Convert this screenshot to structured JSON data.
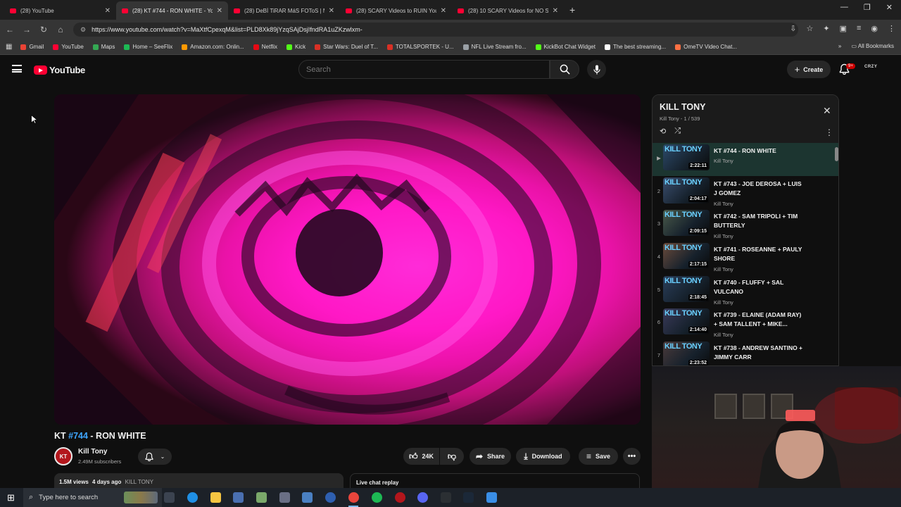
{
  "browser": {
    "tabs": [
      {
        "title": "(28) YouTube",
        "active": false
      },
      {
        "title": "(28) KT #744 - RON WHITE - Yo",
        "active": true
      },
      {
        "title": "(28) DeBİ TiRAR MáS FOToS | M",
        "active": false
      },
      {
        "title": "(28) SCARY Videos to RUIN You",
        "active": false
      },
      {
        "title": "(28) 10 SCARY Videos for NO S",
        "active": false
      }
    ],
    "url": "https://www.youtube.com/watch?v=MaXtfCpexqM&list=PLD8Xk89jYzqSAjDsjIfndRA1uZKzwlxm-",
    "bookmarks": [
      {
        "label": "Gmail",
        "color": "#ea4335"
      },
      {
        "label": "YouTube",
        "color": "#ff0033"
      },
      {
        "label": "Maps",
        "color": "#34a853"
      },
      {
        "label": "Home – SeeFlix",
        "color": "#1db954"
      },
      {
        "label": "Amazon.com: Onlin...",
        "color": "#ff9900"
      },
      {
        "label": "Netflix",
        "color": "#e50914"
      },
      {
        "label": "Kick",
        "color": "#53fc18"
      },
      {
        "label": "Star Wars: Duel of T...",
        "color": "#d93025"
      },
      {
        "label": "TOTALSPORTEK - U...",
        "color": "#d93025"
      },
      {
        "label": "NFL Live Stream fro...",
        "color": "#9aa0a6"
      },
      {
        "label": "KickBot Chat Widget",
        "color": "#53fc18"
      },
      {
        "label": "The best streaming...",
        "color": "#ffffff"
      },
      {
        "label": "OmeTV Video Chat...",
        "color": "#ff7043"
      }
    ],
    "all_bookmarks": "All Bookmarks"
  },
  "youtube": {
    "logo": "YouTube",
    "search_placeholder": "Search",
    "create_label": "Create",
    "notif_count": "9+",
    "avatar_text": "CRZY"
  },
  "video": {
    "title_prefix": "KT ",
    "title_hash": "#744",
    "title_suffix": " - RON WHITE",
    "channel": "Kill Tony",
    "channel_avatar": "KT",
    "subscribers": "2.49M subscribers",
    "likes": "24K",
    "share": "Share",
    "download": "Download",
    "save": "Save",
    "views": "1.5M views",
    "age": "4 days ago",
    "tag": "KILL TONY",
    "live_chat": "Live chat replay"
  },
  "playlist": {
    "title": "KILL TONY",
    "subtitle": "Kill Tony - 1 / 539",
    "items": [
      {
        "idx": "▶",
        "title": "KT #744 - RON WHITE",
        "channel": "Kill Tony",
        "duration": "2:22:11",
        "current": true
      },
      {
        "idx": "2",
        "title": "KT #743 - JOE DEROSA + LUIS\nJ GOMEZ",
        "channel": "Kill Tony",
        "duration": "2:04:17",
        "current": false
      },
      {
        "idx": "3",
        "title": "KT #742 - SAM TRIPOLI + TIM\nBUTTERLY",
        "channel": "Kill Tony",
        "duration": "2:09:15",
        "current": false
      },
      {
        "idx": "4",
        "title": "KT #741 - ROSEANNE + PAULY\nSHORE",
        "channel": "Kill Tony",
        "duration": "2:17:15",
        "current": false
      },
      {
        "idx": "5",
        "title": "KT #740 - FLUFFY + SAL\nVULCANO",
        "channel": "Kill Tony",
        "duration": "2:18:45",
        "current": false
      },
      {
        "idx": "6",
        "title": "KT #739 - ELAINE (ADAM RAY)\n+ SAM TALLENT + MIKE...",
        "channel": "Kill Tony",
        "duration": "2:14:40",
        "current": false
      },
      {
        "idx": "7",
        "title": "KT #738 - ANDREW SANTINO +\nJIMMY CARR",
        "channel": "Kill Tony",
        "duration": "2:23:52",
        "current": false
      }
    ]
  },
  "taskbar": {
    "search_placeholder": "Type here to search"
  }
}
